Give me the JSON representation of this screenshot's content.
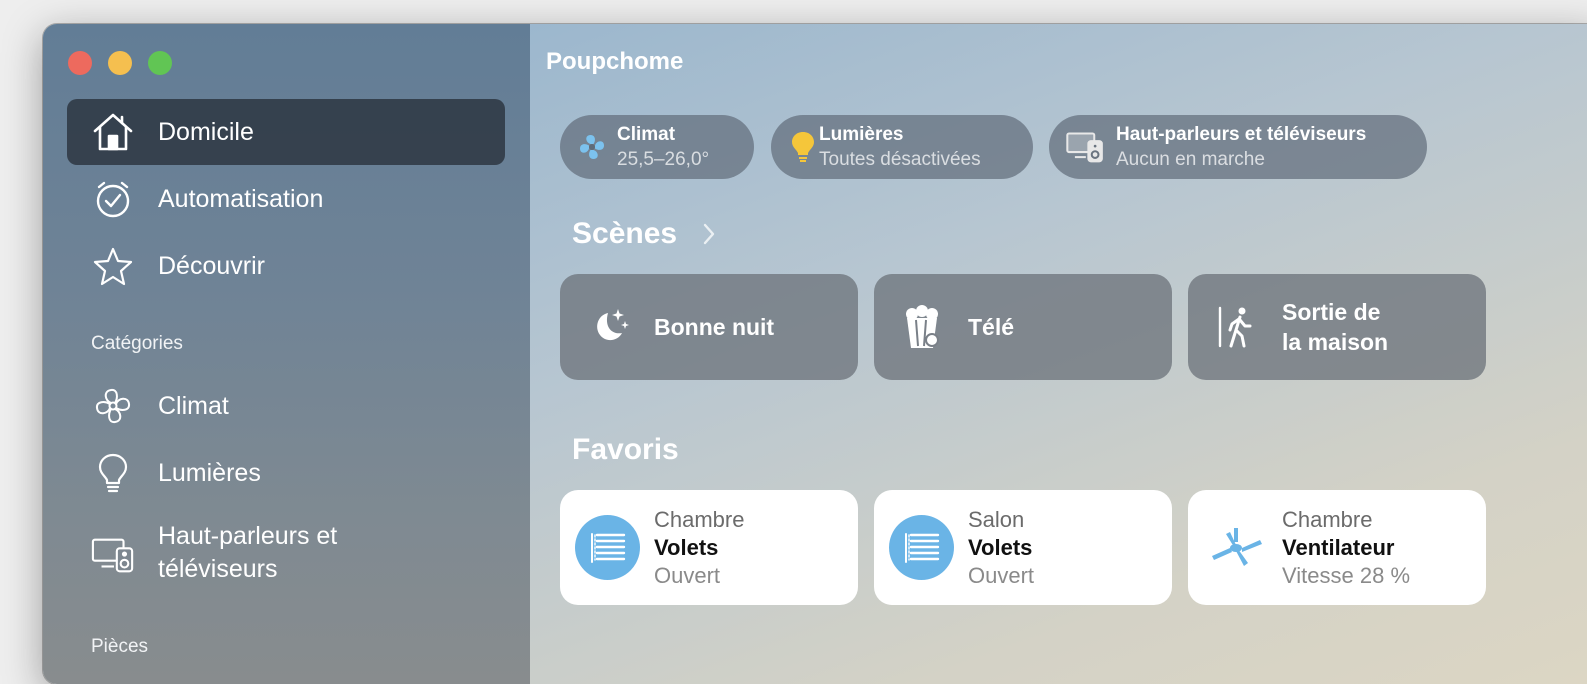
{
  "window": {
    "controls": [
      "close",
      "minimize",
      "zoom"
    ]
  },
  "sidebar": {
    "items": [
      {
        "label": "Domicile",
        "icon": "house-icon",
        "active": true
      },
      {
        "label": "Automatisation",
        "icon": "clock-check-icon",
        "active": false
      },
      {
        "label": "Découvrir",
        "icon": "star-icon",
        "active": false
      }
    ],
    "categories_title": "Catégories",
    "categories": [
      {
        "label": "Climat",
        "icon": "fan-icon"
      },
      {
        "label": "Lumières",
        "icon": "lightbulb-icon"
      },
      {
        "label_line1": "Haut-parleurs et",
        "label_line2": "téléviseurs",
        "icon": "speaker-tv-icon"
      }
    ],
    "rooms_title_partial": "Pièces"
  },
  "main": {
    "home_name": "Poupchome",
    "pills": [
      {
        "title": "Climat",
        "subtitle": "25,5–26,0°",
        "icon": "fan-icon",
        "icon_color": "#7cc2ee"
      },
      {
        "title": "Lumières",
        "subtitle": "Toutes désactivées",
        "icon": "lightbulb-icon",
        "icon_color": "#f5c63a"
      },
      {
        "title": "Haut-parleurs et téléviseurs",
        "subtitle": "Aucun en marche",
        "icon": "speaker-tv-icon",
        "icon_color": "#e8e8e8"
      }
    ],
    "scenes_title": "Scènes",
    "scenes": [
      {
        "label": "Bonne nuit",
        "icon": "moon-stars-icon"
      },
      {
        "label": "Télé",
        "icon": "popcorn-icon"
      },
      {
        "label_line1": "Sortie de",
        "label_line2": "la maison",
        "icon": "walking-person-icon"
      }
    ],
    "favorites_title": "Favoris",
    "favorites": [
      {
        "room": "Chambre",
        "name": "Volets",
        "state": "Ouvert",
        "icon": "blinds-icon"
      },
      {
        "room": "Salon",
        "name": "Volets",
        "state": "Ouvert",
        "icon": "blinds-icon"
      },
      {
        "room": "Chambre",
        "name": "Ventilateur",
        "state": "Vitesse 28 %",
        "icon": "ceiling-fan-icon"
      }
    ]
  },
  "colors": {
    "accent_blue": "#6ab4e6",
    "sidebar_active": "#2d3641"
  }
}
